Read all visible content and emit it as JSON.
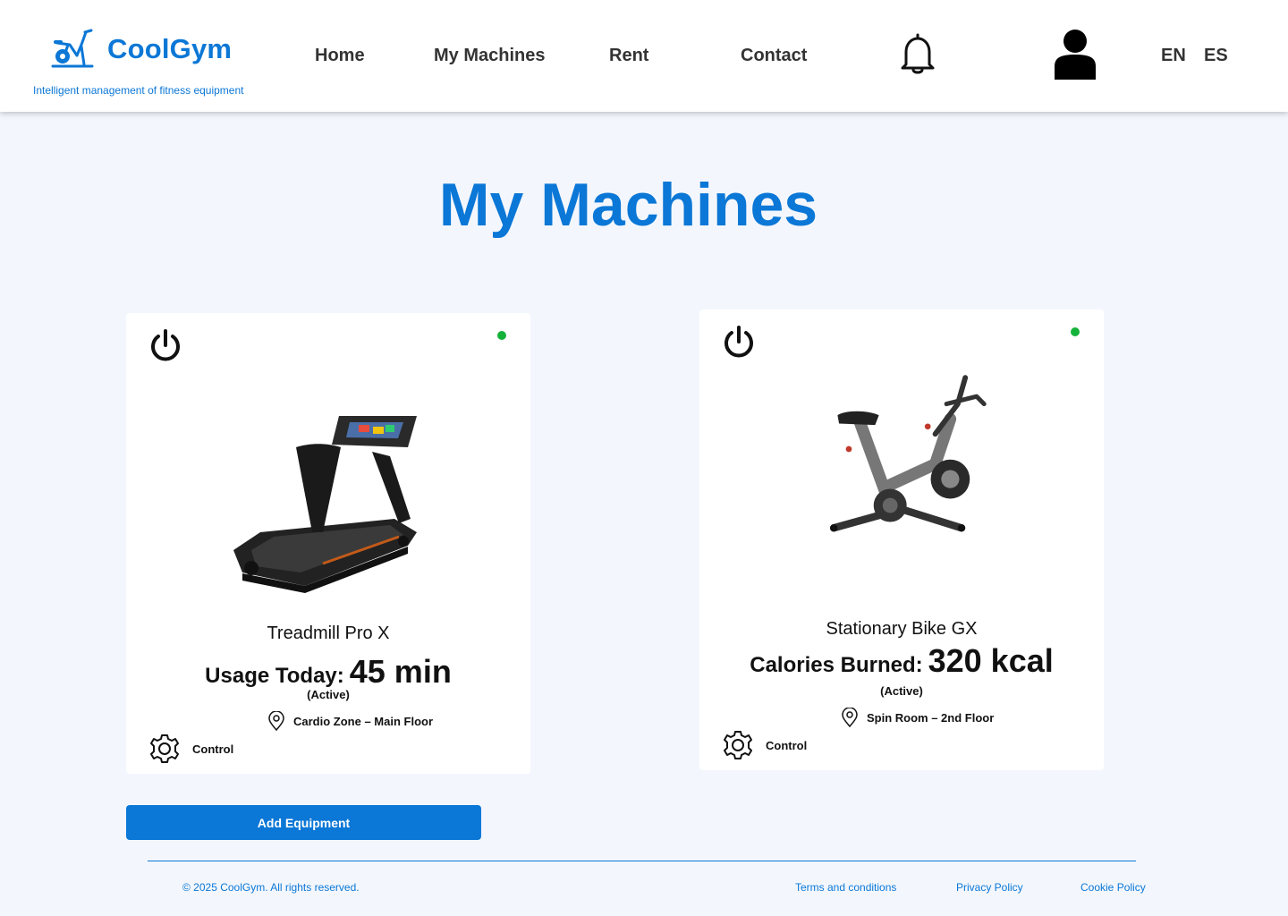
{
  "brand": {
    "name": "CoolGym",
    "tagline": "Intelligent management of fitness equipment",
    "color": "#0b77d6"
  },
  "nav": {
    "items": [
      "Home",
      "My Machines",
      "Rent",
      "Contact"
    ]
  },
  "header": {
    "bell_icon": "bell-icon",
    "user_icon": "user-icon",
    "languages": [
      "EN",
      "ES"
    ]
  },
  "page": {
    "title": "My Machines"
  },
  "machines": [
    {
      "name": "Treadmill Pro X",
      "stat_label": "Usage Today:",
      "stat_value": "45 min",
      "status": "(Active)",
      "status_color": "#15b23a",
      "location": "Cardio Zone – Main Floor",
      "control_label": "Control",
      "image": "treadmill-image"
    },
    {
      "name": "Stationary Bike GX",
      "stat_label": "Calories Burned:",
      "stat_value": "320 kcal",
      "status": "(Active)",
      "status_color": "#15b23a",
      "location": "Spin Room – 2nd Floor",
      "control_label": "Control",
      "image": "stationary-bike-image"
    }
  ],
  "actions": {
    "add_equipment": "Add Equipment"
  },
  "footer": {
    "copyright": "© 2025 CoolGym. All rights reserved.",
    "links": [
      "Terms and conditions",
      "Privacy Policy",
      "Cookie Policy"
    ]
  }
}
